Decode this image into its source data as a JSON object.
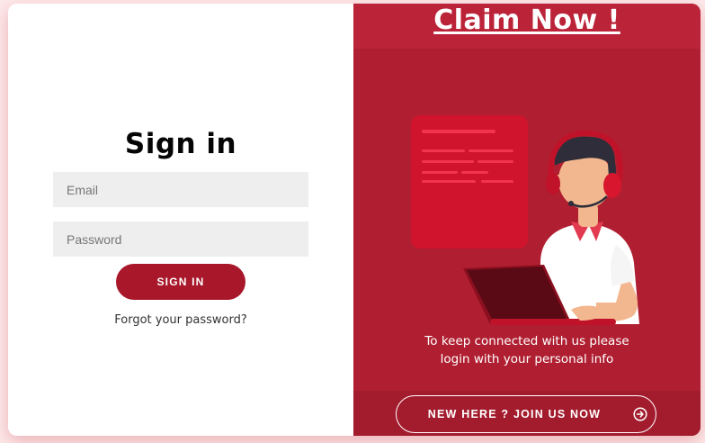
{
  "left": {
    "title": "Sign in",
    "email_placeholder": "Email",
    "password_placeholder": "Password",
    "signin_label": "SIGN IN",
    "forgot_label": "Forgot your password?"
  },
  "right": {
    "claim_label": "Claim Now !",
    "message_line1": "To keep connected with us please",
    "message_line2": "login with your personal info",
    "join_label": "NEW HERE ? JOIN US NOW",
    "join_icon": "arrow-circle-right-icon",
    "illustration": "customer-support-agent-illustration"
  },
  "colors": {
    "brand_red": "#b01f31",
    "button_red": "#a8172a",
    "input_bg": "#eeeeee"
  }
}
